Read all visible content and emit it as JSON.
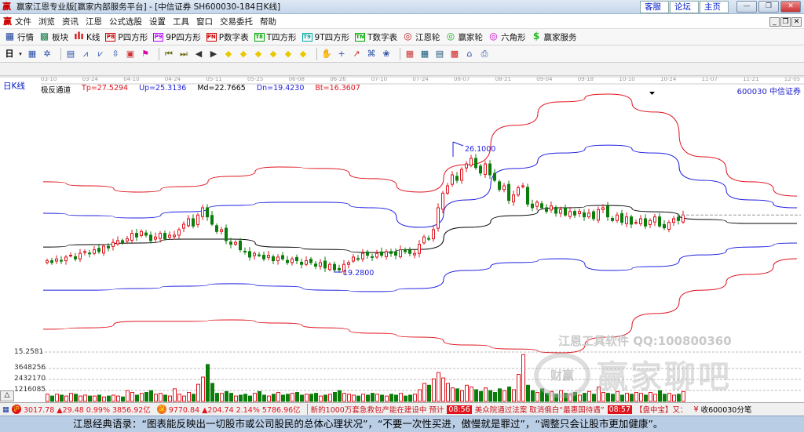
{
  "window": {
    "title": "赢家江恩专业版[赢家内部服务平台] - [中信证券  SH600030-184日K线]",
    "logo": "赢",
    "top_links": [
      "客服",
      "论坛",
      "主页"
    ],
    "controls": [
      "—",
      "❐",
      "✕"
    ]
  },
  "menu": {
    "items": [
      "文件",
      "浏览",
      "资讯",
      "江恩",
      "公式选股",
      "设置",
      "工具",
      "窗口",
      "交易委托",
      "帮助"
    ],
    "mdi_controls": [
      "_",
      "❐",
      "✕"
    ]
  },
  "toolbar": {
    "items": [
      {
        "label": "行情",
        "icon": "grid",
        "color": "#1a3f9a",
        "glyph": "▦"
      },
      {
        "label": "板块",
        "icon": "blocks",
        "color": "#1a7f4a",
        "glyph": "▩"
      },
      {
        "label": "K线",
        "icon": "kline",
        "color": "#d40000",
        "glyph": "ılı"
      },
      {
        "label": "P四方形",
        "icon": "P8",
        "color": "#c00",
        "glyph": "P8"
      },
      {
        "label": "9P四方形",
        "icon": "P9",
        "color": "#b0f",
        "glyph": "P9"
      },
      {
        "label": "P数字表",
        "icon": "PN",
        "color": "#c00",
        "glyph": "PN"
      },
      {
        "label": "T四方形",
        "icon": "T8",
        "color": "#0a0",
        "glyph": "T8"
      },
      {
        "label": "9T四方形",
        "icon": "T9",
        "color": "#0aa",
        "glyph": "T9"
      },
      {
        "label": "T数字表",
        "icon": "TN",
        "color": "#0a0",
        "glyph": "TN"
      },
      {
        "label": "江恩轮",
        "icon": "gann-wheel",
        "color": "#b22",
        "glyph": "◎"
      },
      {
        "label": "赢家轮",
        "icon": "winner-wheel",
        "color": "#2a2",
        "glyph": "◎"
      },
      {
        "label": "六角形",
        "icon": "hexagon",
        "color": "#c0c",
        "glyph": "◎"
      },
      {
        "label": "赢家服务",
        "icon": "dollar",
        "color": "#2b2",
        "glyph": "$"
      }
    ]
  },
  "toolbar2": {
    "period": "日",
    "icons": [
      "calendar-dropdown",
      "pattern",
      "clipboard",
      "chart-up",
      "chart-down",
      "cursor-dropdown",
      "indicator",
      "flag",
      "first",
      "last",
      "prev",
      "next",
      "zoom-in",
      "zoom-out",
      "shift-left",
      "shift-right",
      "expand",
      "compress",
      "hand",
      "crosshair",
      "draw-line",
      "text-tool",
      "gann-tool",
      "calendar",
      "calculator",
      "report",
      "save",
      "network",
      "printer"
    ]
  },
  "chart": {
    "period_label": "日K线",
    "indicator": {
      "name": "极反通道",
      "tp": "Tp=27.5294",
      "up": "Up=25.3136",
      "md": "Md=22.7665",
      "dn": "Dn=19.4230",
      "bt": "Bt=16.3607"
    },
    "stock": "600030  中信证券",
    "high_mark": "26.1000",
    "low_mark": "19.2800",
    "colors": {
      "up": "#e0141e",
      "down": "#0a7d0a",
      "tp": "#e0141e",
      "upper": "#1f1fe0",
      "mid": "#000000",
      "lower": "#1f1fe0",
      "bt": "#e0141e"
    },
    "volume_labels": [
      "15.2581",
      "3648256",
      "2432170",
      "1216085"
    ],
    "watermark1": "江恩工具软件  QQ:100800360",
    "watermark2": "赢家聊吧",
    "seal": "财赢"
  },
  "chart_data": {
    "type": "candlestick",
    "x_ticks": [
      "03-10",
      "03-24",
      "04-10",
      "04-24",
      "05-11",
      "05-25",
      "06-08",
      "06-26",
      "07-10",
      "07-24",
      "08-07",
      "08-21",
      "09-04",
      "09-18",
      "10-10",
      "10-24",
      "11-07",
      "11-21",
      "12-05"
    ],
    "closes": [
      19.9,
      19.8,
      20.0,
      19.9,
      20.1,
      20.2,
      20.0,
      20.3,
      20.4,
      20.3,
      20.5,
      20.4,
      20.7,
      20.6,
      20.9,
      21.0,
      20.9,
      21.1,
      21.4,
      21.2,
      21.5,
      21.3,
      21.0,
      21.2,
      21.4,
      21.1,
      21.3,
      21.3,
      21.6,
      21.9,
      22.2,
      21.8,
      22.4,
      22.8,
      22.3,
      21.9,
      21.5,
      21.6,
      21.0,
      20.8,
      20.9,
      20.5,
      20.4,
      20.1,
      20.3,
      20.2,
      20.0,
      20.2,
      19.9,
      20.1,
      20.0,
      19.8,
      20.0,
      19.9,
      19.7,
      19.9,
      19.8,
      19.6,
      19.8,
      19.5,
      19.7,
      19.4,
      19.4,
      19.7,
      19.8,
      20.1,
      20.0,
      20.3,
      20.2,
      20.1,
      20.3,
      20.2,
      20.4,
      20.3,
      20.2,
      20.5,
      20.4,
      20.3,
      20.3,
      20.8,
      21.2,
      21.1,
      21.6,
      22.8,
      23.6,
      24.0,
      24.6,
      24.3,
      24.9,
      25.2,
      25.5,
      25.0,
      24.7,
      25.2,
      24.6,
      24.3,
      23.8,
      24.0,
      23.2,
      23.5,
      23.9,
      24.0,
      23.0,
      22.8,
      23.1,
      22.8,
      22.6,
      22.9,
      22.5,
      22.7,
      22.4,
      22.6,
      22.4,
      22.6,
      22.3,
      22.5,
      22.2,
      22.7,
      22.8,
      22.3,
      22.1,
      22.4,
      22.0,
      22.3,
      21.9,
      22.0,
      22.2,
      21.8,
      22.1,
      22.3,
      21.8,
      21.7,
      22.0,
      22.2,
      22.1,
      22.4
    ],
    "volume_millions": [
      0.8,
      0.6,
      0.8,
      0.7,
      0.6,
      0.9,
      0.8,
      0.6,
      0.7,
      0.6,
      0.6,
      0.7,
      0.5,
      0.6,
      0.7,
      0.6,
      0.5,
      1.2,
      1.0,
      0.7,
      0.9,
      1.0,
      1.2,
      0.8,
      0.9,
      0.7,
      0.6,
      1.4,
      0.8,
      0.6,
      1.0,
      0.8,
      1.9,
      2.7,
      4.1,
      2.0,
      0.9,
      0.9,
      1.1,
      0.9,
      0.6,
      0.7,
      0.8,
      0.6,
      0.9,
      1.1,
      0.7,
      0.6,
      0.8,
      1.0,
      0.7,
      0.8,
      0.9,
      1.0,
      0.7,
      0.8,
      0.8,
      0.9,
      0.6,
      0.7,
      0.8,
      1.0,
      1.2,
      0.9,
      0.8,
      0.7,
      0.6,
      0.8,
      0.7,
      0.9,
      0.8,
      0.7,
      0.6,
      0.8,
      0.7,
      0.9,
      0.6,
      0.7,
      0.8,
      1.3,
      2.0,
      1.8,
      2.5,
      3.2,
      2.6,
      2.0,
      1.5,
      1.4,
      1.2,
      1.8,
      1.6,
      1.3,
      1.1,
      1.5,
      1.2,
      1.0,
      1.4,
      1.2,
      1.6,
      1.3,
      3.0,
      5.2,
      1.8,
      1.2,
      1.0,
      1.4,
      0.9,
      1.1,
      0.8,
      1.2,
      0.9,
      0.8,
      1.0,
      0.7,
      0.9,
      1.1,
      0.8,
      1.6,
      1.0,
      0.9,
      0.8,
      1.1,
      0.7,
      0.9,
      0.8,
      1.0,
      0.9,
      0.7,
      1.0,
      0.8,
      1.2,
      0.8,
      0.9,
      0.7,
      0.8,
      1.1
    ],
    "bands": {
      "tp": [
        24.22,
        24.0,
        23.66,
        23.96,
        24.52,
        25.03,
        24.95,
        24.39,
        23.66,
        25.16,
        27.31,
        28.6,
        29.02,
        28.04,
        25.59,
        24.22,
        23.44
      ],
      "up": [
        22.5,
        22.37,
        22.24,
        22.58,
        22.93,
        23.1,
        23.1,
        22.8,
        21.73,
        23.23,
        24.95,
        25.8,
        26.23,
        25.8,
        24.3,
        23.23,
        22.8
      ],
      "md": [
        20.65,
        20.78,
        20.87,
        21.08,
        21.08,
        20.65,
        20.52,
        20.35,
        20.52,
        21.73,
        22.37,
        22.8,
        22.93,
        22.58,
        22.16,
        21.94,
        21.94
      ],
      "dn": [
        18.29,
        18.29,
        18.38,
        18.51,
        18.64,
        18.51,
        18.29,
        18.21,
        18.38,
        19.37,
        19.8,
        20.01,
        19.37,
        19.58,
        20.22,
        20.65,
        20.87
      ],
      "bt": [
        16.15,
        16.23,
        16.58,
        16.58,
        16.66,
        16.49,
        16.23,
        15.93,
        15.72,
        15.29,
        15.07,
        14.86,
        15.72,
        17.01,
        18.29,
        19.15,
        20.01
      ]
    },
    "y_range": [
      15.26,
      29.88
    ],
    "high": 26.1,
    "low": 19.28
  },
  "status": {
    "sh": {
      "badge": "沪",
      "text": "3017.78 ▲29.48 0.99% 3856.92亿"
    },
    "sz": {
      "badge": "深",
      "text": "9770.84 ▲204.74 2.14% 5786.96亿"
    },
    "news1": "新的1000万套急救包产能在建设中 预计",
    "time1": "08:56",
    "news2": "美众院通过法案 取消俄白“最惠国待遇”",
    "time2": "08:57",
    "news3": "【盘中宝】又：",
    "signal": "收600030分笔"
  },
  "quote": "江恩经典语录：“图表能反映出一切股市或公司股民的总体心理状况”，“不要一次性买进，傲慢就是罪过”，“调整只会让股市更加健康”。"
}
